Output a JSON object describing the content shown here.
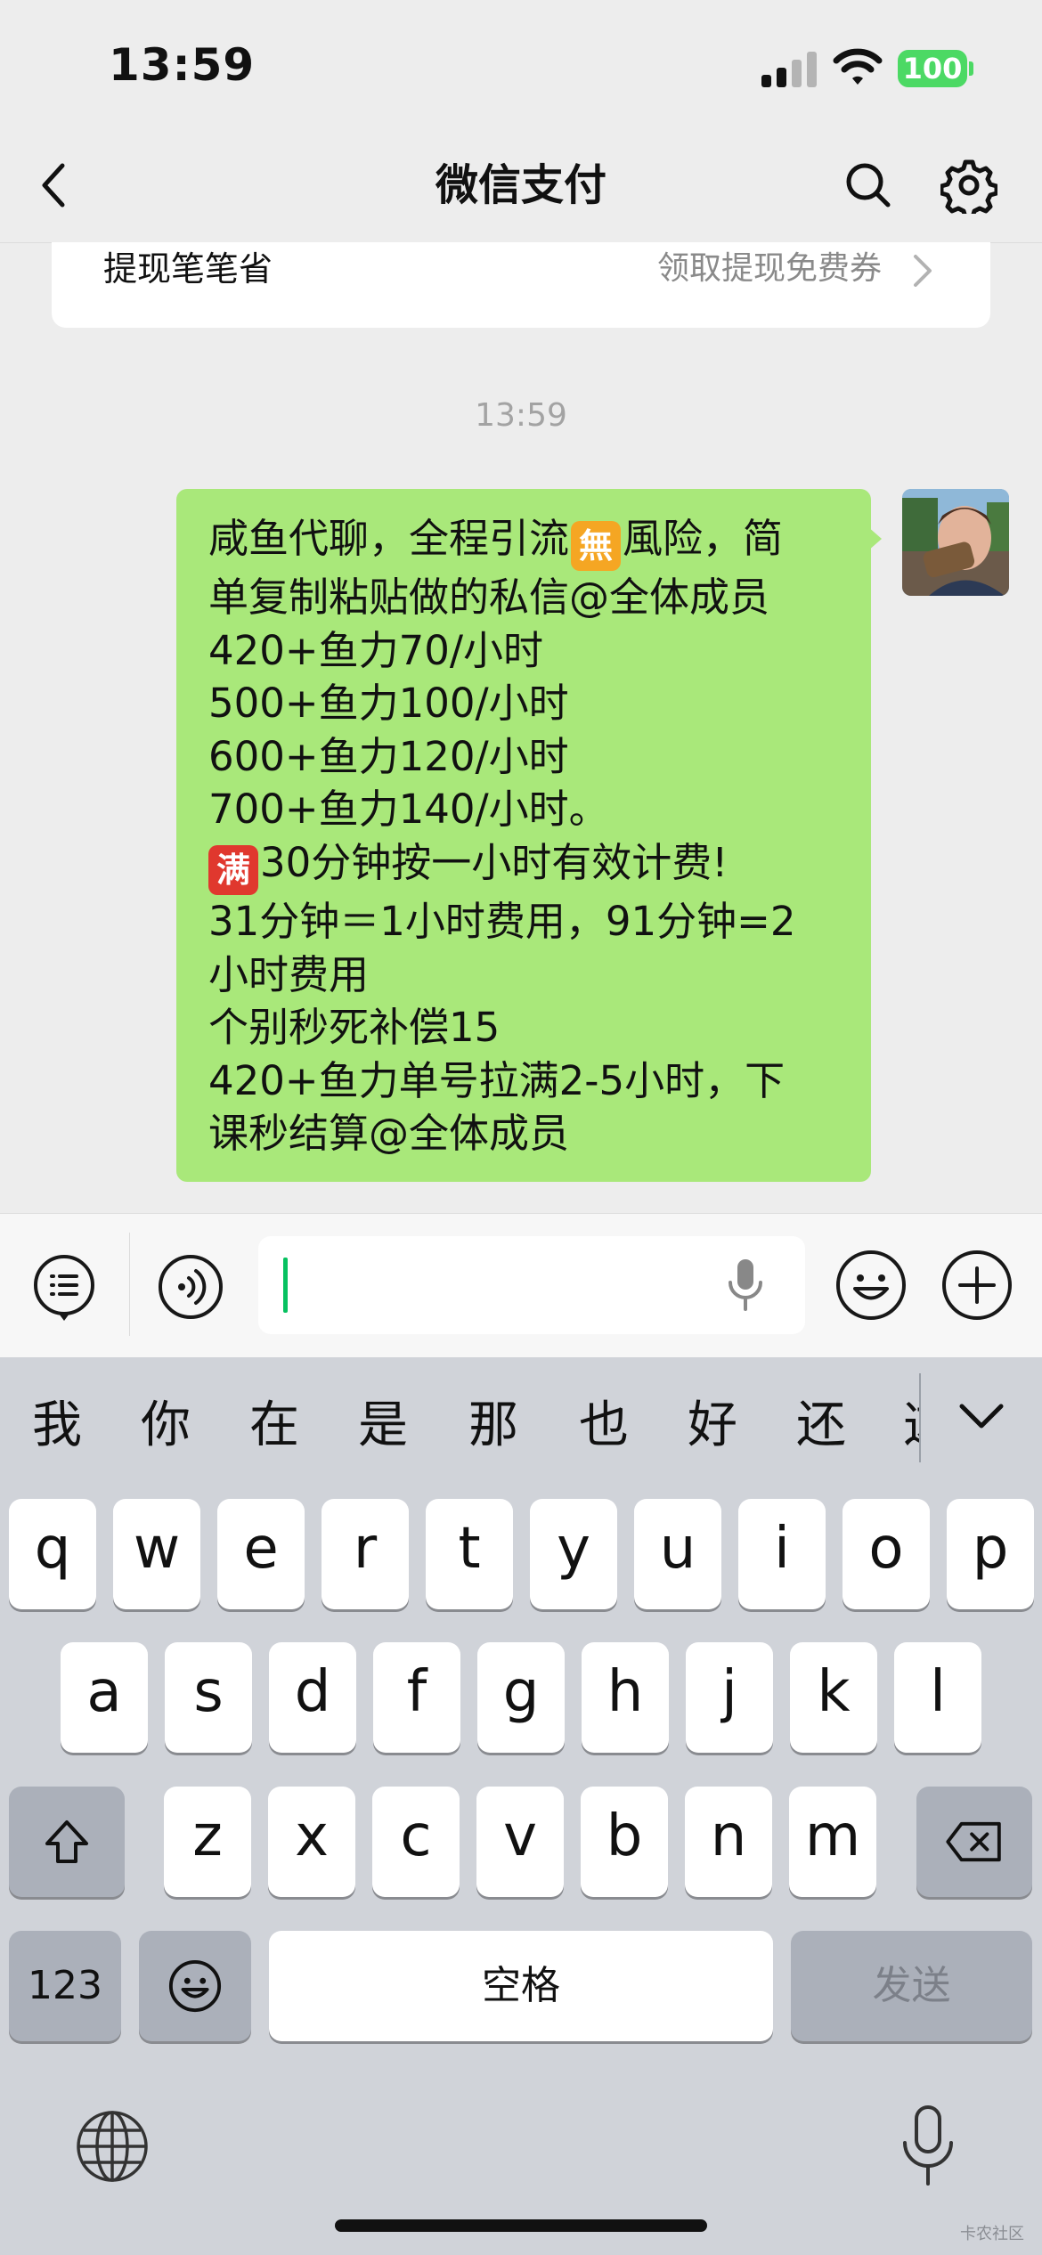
{
  "status": {
    "time": "13:59",
    "battery": "100"
  },
  "nav": {
    "title": "微信支付"
  },
  "card": {
    "label": "提现笔笔省",
    "value": "领取提现免费券"
  },
  "timestamp": "13:59",
  "message": {
    "lines": [
      [
        "咸鱼代聊，全程引流",
        "風险，简"
      ],
      [
        "单复制粘贴做的私信@全体成员"
      ],
      [
        "420+鱼力70/小时"
      ],
      [
        "500+鱼力100/小时"
      ],
      [
        "600+鱼力120/小时"
      ],
      [
        "700+鱼力140/小时。"
      ],
      [
        "",
        "30分钟按一小时有效计费!"
      ],
      [
        "31分钟＝1小时费用，91分钟=2"
      ],
      [
        "小时费用"
      ],
      [
        "个别秒死补偿15"
      ],
      [
        "420+鱼力单号拉满2-5小时，下"
      ],
      [
        "课秒结算@全体成员"
      ]
    ],
    "emoji_1": "無",
    "emoji_1_color": "#f5a623",
    "emoji_2": "满",
    "emoji_2_color": "#e0382e"
  },
  "input": {
    "placeholder": ""
  },
  "keyboard": {
    "candidates": [
      "我",
      "你",
      "在",
      "是",
      "那",
      "也",
      "好",
      "还",
      "这"
    ],
    "row1": [
      "q",
      "w",
      "e",
      "r",
      "t",
      "y",
      "u",
      "i",
      "o",
      "p"
    ],
    "row2": [
      "a",
      "s",
      "d",
      "f",
      "g",
      "h",
      "j",
      "k",
      "l"
    ],
    "row3": [
      "z",
      "x",
      "c",
      "v",
      "b",
      "n",
      "m"
    ],
    "num_key": "123",
    "space_key": "空格",
    "send_key": "发送"
  },
  "watermark": "卡农社区",
  "colors": {
    "bubble": "#a9e87a",
    "accent": "#07c160",
    "background": "#ededed"
  }
}
